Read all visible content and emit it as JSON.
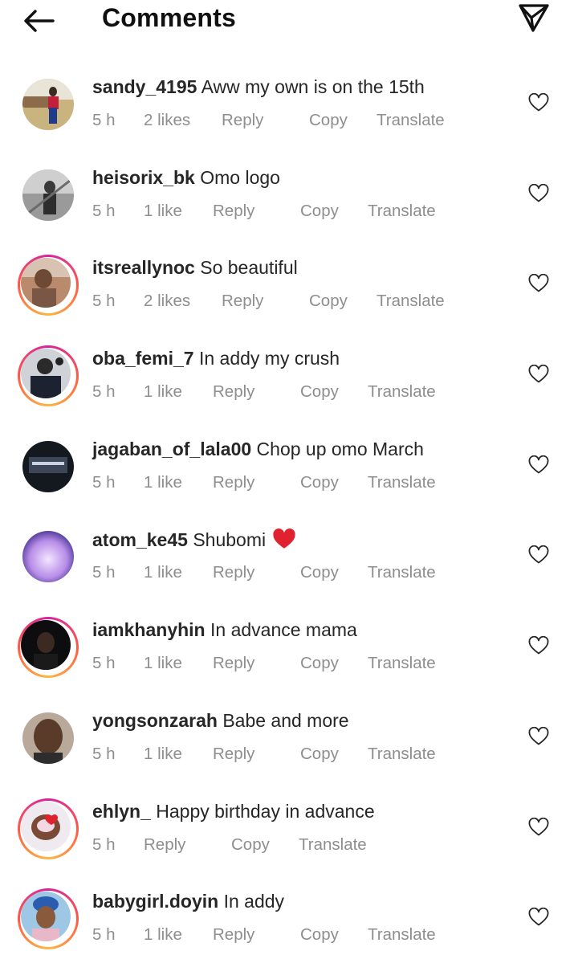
{
  "header": {
    "title": "Comments"
  },
  "comments": [
    {
      "username": "sandy_4195",
      "text": "Aww my own is on the 15th",
      "time": "5 h",
      "likes": "2 likes",
      "reply": "Reply",
      "copy": "Copy",
      "translate": "Translate"
    },
    {
      "username": "heisorix_bk",
      "text": "Omo logo",
      "time": "5 h",
      "likes": "1 like",
      "reply": "Reply",
      "copy": "Copy",
      "translate": "Translate"
    },
    {
      "username": "itsreallynoc",
      "text": "So beautiful",
      "time": "5 h",
      "likes": "2 likes",
      "reply": "Reply",
      "copy": "Copy",
      "translate": "Translate"
    },
    {
      "username": "oba_femi_7",
      "text": "In addy my crush",
      "time": "5 h",
      "likes": "1 like",
      "reply": "Reply",
      "copy": "Copy",
      "translate": "Translate"
    },
    {
      "username": "jagaban_of_lala00",
      "text": "Chop up omo March",
      "time": "5 h",
      "likes": "1 like",
      "reply": "Reply",
      "copy": "Copy",
      "translate": "Translate"
    },
    {
      "username": "atom_ke45",
      "text": "Shubomi",
      "time": "5 h",
      "likes": "1 like",
      "reply": "Reply",
      "copy": "Copy",
      "translate": "Translate"
    },
    {
      "username": "iamkhanyhin",
      "text": "In advance mama",
      "time": "5 h",
      "likes": "1 like",
      "reply": "Reply",
      "copy": "Copy",
      "translate": "Translate"
    },
    {
      "username": "yongsonzarah",
      "text": "Babe and more",
      "time": "5 h",
      "likes": "1 like",
      "reply": "Reply",
      "copy": "Copy",
      "translate": "Translate"
    },
    {
      "username": "ehlyn_",
      "text": "Happy birthday in advance",
      "time": "5 h",
      "likes": "",
      "reply": "Reply",
      "copy": "Copy",
      "translate": "Translate"
    },
    {
      "username": "babygirl.doyin",
      "text": "In addy",
      "time": "5 h",
      "likes": "1 like",
      "reply": "Reply",
      "copy": "Copy",
      "translate": "Translate"
    }
  ],
  "icons": {
    "back": "arrow-left-icon",
    "send": "paper-plane-icon",
    "like": "heart-outline-icon",
    "emoji_red_heart": "red-heart-emoji"
  },
  "colors": {
    "primary_text": "#262626",
    "secondary_text": "#8e8e8e",
    "story_ring_start": "#d6249f",
    "story_ring_end": "#fdb640",
    "red_heart": "#e0212f"
  }
}
